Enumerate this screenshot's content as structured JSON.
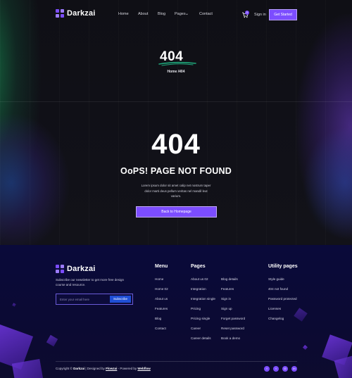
{
  "brand": {
    "name": "Darkzai"
  },
  "nav": {
    "links": [
      "Home",
      "About",
      "Blog",
      "Pages",
      "Contact"
    ],
    "cart_count": "0",
    "signin": "Sign in",
    "cta": "Get Started"
  },
  "hero": {
    "code": "404",
    "breadcrumb": "Home /404"
  },
  "error": {
    "code": "404",
    "title": "OoPS! PAGE NOT FOUND",
    "description": "Lorem ipsum dolor sit amet calip net nostrum taper dolor marti deus pellum veritas nel mandil leut varium.",
    "button": "Back to Homepage"
  },
  "footer": {
    "subscribe_text": "Subscribe our newsletter to get more free design course and resource.",
    "email_placeholder": "Enter your email here",
    "subscribe_button": "Subscribe",
    "menu": {
      "title": "Menu",
      "items": [
        "Home",
        "Home 02",
        "About us",
        "Features",
        "Blog",
        "Contact"
      ]
    },
    "pages": {
      "title": "Pages",
      "col1": [
        "About us 02",
        "Integration",
        "Integration single",
        "Pricing",
        "Pricing single",
        "Career",
        "Career details"
      ],
      "col2": [
        "Blog details",
        "Features",
        "Sign in",
        "Sign up",
        "Forget password",
        "Reset password",
        "Book a demo"
      ]
    },
    "utility": {
      "title": "Utility pages",
      "items": [
        "Style guide",
        "404 not found",
        "Password protected",
        "Licenses",
        "Changelog"
      ]
    },
    "copyright": {
      "prefix": "Copyright ©",
      "brand": "Darkzai",
      "designed": "| Designed by",
      "designer": "Flowzai",
      "powered": "- Powered by",
      "platform": "Webflow"
    },
    "social": [
      "facebook-icon",
      "twitter-icon",
      "instagram-icon",
      "linkedin-icon"
    ]
  },
  "colors": {
    "accent": "#7c4dff",
    "footer_bg": "#0a0a3a",
    "subscribe_button": "#1f4fd6"
  }
}
